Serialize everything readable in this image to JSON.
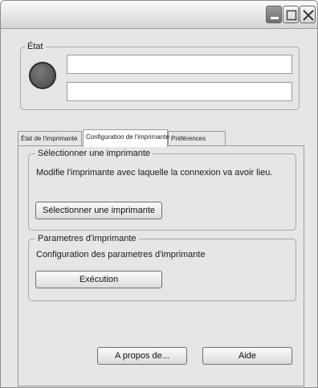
{
  "window": {
    "buttons": [
      "minimize",
      "maximize",
      "close"
    ]
  },
  "status": {
    "group_label": "État",
    "indicator_color": "#555555",
    "field1_value": "",
    "field2_value": ""
  },
  "tabs": [
    {
      "label": "État de l'imprimante",
      "active": false
    },
    {
      "label": "Configuration de l'imprimante",
      "active": true
    },
    {
      "label": "Préférences",
      "active": false
    }
  ],
  "select_printer": {
    "title": "Sélectionner une imprimante",
    "description": "Modifie l'imprimante avec laquelle la connexion va avoir lieu.",
    "button_label": "Sélectionner une imprimante"
  },
  "printer_params": {
    "title": "Parametres d'imprimante",
    "description": "Configuration des parametres d'imprimante",
    "button_label": "Exécution"
  },
  "footer": {
    "about_label": "A propos de...",
    "help_label": "Aide"
  }
}
